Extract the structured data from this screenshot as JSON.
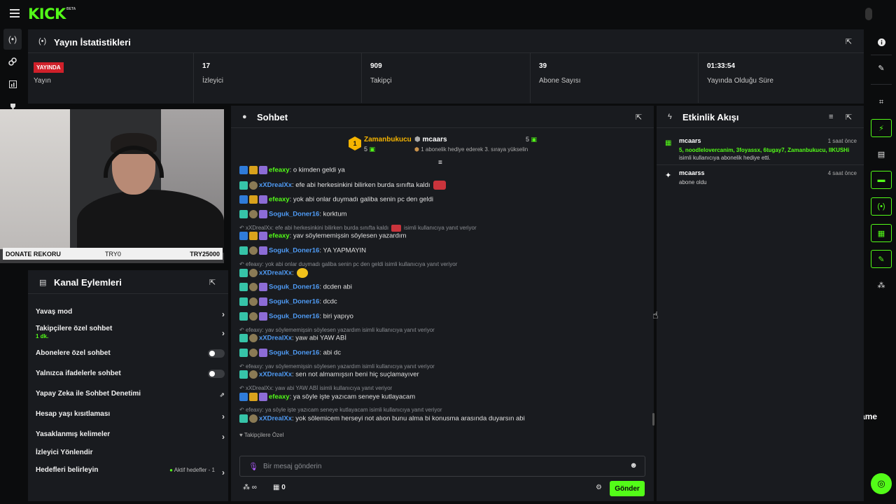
{
  "brand": {
    "logo": "KICK",
    "beta": "BETA"
  },
  "stats_panel": {
    "title": "Yayın İstatistikleri",
    "live_badge": "YAYINDA",
    "cells": [
      {
        "value": "",
        "label": "Yayın"
      },
      {
        "value": "17",
        "label": "İzleyici"
      },
      {
        "value": "909",
        "label": "Takipçi"
      },
      {
        "value": "39",
        "label": "Abone Sayısı"
      },
      {
        "value": "01:33:54",
        "label": "Yayında Olduğu Süre"
      }
    ]
  },
  "video_overlay": {
    "label": "DONATE REKORU",
    "min": "TRY0",
    "max": "TRY25000"
  },
  "kanal": {
    "title": "Kanal Eylemleri",
    "rows": [
      {
        "label": "Yavaş mod",
        "control": "arrow"
      },
      {
        "label": "Takipçilere özel sohbet",
        "sub": "1 dk.",
        "control": "arrow"
      },
      {
        "label": "Abonelere özel sohbet",
        "control": "toggle"
      },
      {
        "label": "Yalnızca ifadelerle sohbet",
        "control": "toggle"
      },
      {
        "label": "Yapay Zeka ile Sohbet Denetimi",
        "control": "external"
      },
      {
        "label": "Hesap yaşı kısıtlaması",
        "control": "arrow"
      },
      {
        "label": "Yasaklanmış kelimeler",
        "control": "arrow"
      },
      {
        "label": "İzleyici Yönlendir",
        "control": "none"
      },
      {
        "label": "Hedefleri belirleyin",
        "control": "arrow",
        "extra": "Aktif hedefler - 1"
      }
    ]
  },
  "chat": {
    "title": "Sohbet",
    "leaderboard": {
      "first": {
        "rank": "1",
        "name": "Zamanbukucu",
        "count": "5"
      },
      "second": {
        "name": "mcaars",
        "count": "5",
        "note": "1 abonelik hediye ederek 3. sıraya yükselin"
      }
    },
    "messages": [
      {
        "type": "msg",
        "user": "efeaxy",
        "color": "#53fc18",
        "text": ": o kimden geldi ya"
      },
      {
        "type": "msg",
        "user": "xXDrealXx",
        "color": "#4f9bf5",
        "text": ": efe abi herkesinkini bilirken burda sınıfta kaldı"
      },
      {
        "type": "msg",
        "user": "efeaxy",
        "color": "#53fc18",
        "text": ": yok abi onlar duymadı galiba senin pc den geldi"
      },
      {
        "type": "msg",
        "user": "Soguk_Doner16",
        "color": "#4f9bf5",
        "text": ": korktum"
      },
      {
        "type": "reply",
        "text": "xXDrealXx: efe abi herkesinkini bilirken burda sınıfta kaldı",
        "suffix": "isimli kullanıcıya yanıt veriyor"
      },
      {
        "type": "msg",
        "user": "efeaxy",
        "color": "#53fc18",
        "text": ": yav söylememişsin söylesen yazardım"
      },
      {
        "type": "msg",
        "user": "Soguk_Doner16",
        "color": "#4f9bf5",
        "text": ": YA YAPMAYIN"
      },
      {
        "type": "reply",
        "text": "efeaxy: yok abi onlar duymadı galiba senin pc den geldi isimli kullanıcıya yanıt veriyor",
        "suffix": ""
      },
      {
        "type": "msg",
        "user": "xXDrealXx",
        "color": "#4f9bf5",
        "text": ":"
      },
      {
        "type": "msg",
        "user": "Soguk_Doner16",
        "color": "#4f9bf5",
        "text": ": dcden abi"
      },
      {
        "type": "msg",
        "user": "Soguk_Doner16",
        "color": "#4f9bf5",
        "text": ": dcdc"
      },
      {
        "type": "msg",
        "user": "Soguk_Doner16",
        "color": "#4f9bf5",
        "text": ": biri yapıyo"
      },
      {
        "type": "reply",
        "text": "efeaxy: yav söylememişsin söylesen yazardım isimli kullanıcıya yanıt veriyor",
        "suffix": ""
      },
      {
        "type": "msg",
        "user": "xXDrealXx",
        "color": "#4f9bf5",
        "text": ": yaw abi YAW ABİ"
      },
      {
        "type": "msg",
        "user": "Soguk_Doner16",
        "color": "#4f9bf5",
        "text": ": abi dc"
      },
      {
        "type": "reply",
        "text": "efeaxy: yav söylememişsin söylesen yazardım isimli kullanıcıya yanıt veriyor",
        "suffix": ""
      },
      {
        "type": "msg",
        "user": "xXDrealXx",
        "color": "#4f9bf5",
        "text": ": sen not almamışsın beni hiç suçlamayıver"
      },
      {
        "type": "reply",
        "text": "xXDrealXx: yaw abi YAW ABİ isimli kullanıcıya yanıt veriyor",
        "suffix": ""
      },
      {
        "type": "msg",
        "user": "efeaxy",
        "color": "#53fc18",
        "text": ": ya söyle işte yazıcam seneye kutlayacam"
      },
      {
        "type": "reply",
        "text": "efeaxy: ya söyle işte yazıcam seneye kutlayacam isimli kullanıcıya yanıt veriyor",
        "suffix": ""
      },
      {
        "type": "msg",
        "user": "xXDrealXx",
        "color": "#4f9bf5",
        "text": ": yok sölemicem herseyi not alıon bunu alma bi konusma arasında duyarsın abi"
      }
    ],
    "emote_section": "Takipçilere Özel",
    "input_placeholder": "Bir mesaj gönderin",
    "points": "∞",
    "gift_count": "0",
    "send_label": "Gönder"
  },
  "activity": {
    "title": "Etkinlik Akışı",
    "items": [
      {
        "user": "mcaars",
        "time": "1 saat önce",
        "names": "5, noodlelovercanim, 3foyassx, 6tugay7, Zamanbukucu, IIKUSHi",
        "desc": "isimli kullanıcıya abonelik hediye etti."
      },
      {
        "user": "mcaarss",
        "time": "4 saat önce",
        "desc": "abone oldu"
      }
    ]
  },
  "watermark": "ByNoGame"
}
